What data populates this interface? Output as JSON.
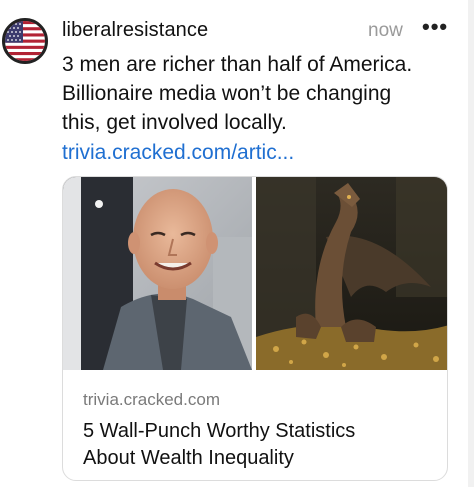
{
  "post": {
    "username": "liberalresistance",
    "time": "now",
    "more_label": "•••",
    "text_lines": [
      "3 men are richer than half of America.",
      "Billionaire media won’t be changing",
      "this, get involved locally."
    ],
    "link_text": "trivia.cracked.com/artic..."
  },
  "card": {
    "domain": "trivia.cracked.com",
    "title_lines": [
      "5 Wall-Punch Worthy Statistics",
      "About Wealth Inequality"
    ]
  },
  "icons": {
    "avatar": "us-flag-avatar-icon",
    "more": "more-options-icon"
  },
  "colors": {
    "link": "#1f6fd1",
    "muted": "#9a9a9a"
  }
}
